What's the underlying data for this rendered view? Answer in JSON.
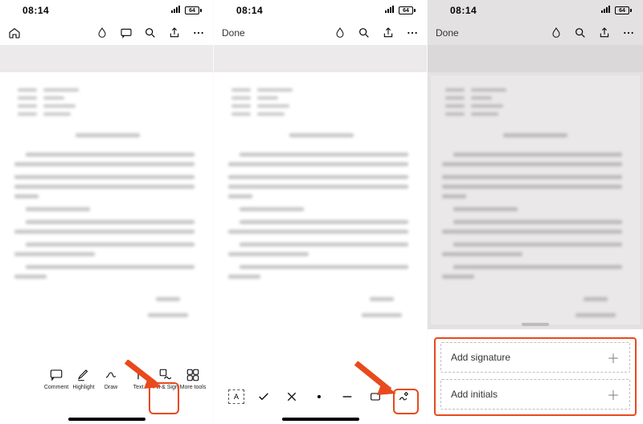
{
  "status": {
    "time": "08:14",
    "battery_label": "64"
  },
  "nav": {
    "done": "Done"
  },
  "toolbar_main": {
    "items": [
      {
        "label": "Comment"
      },
      {
        "label": "Highlight"
      },
      {
        "label": "Draw"
      },
      {
        "label": "Text"
      },
      {
        "label": "Fill & Sign"
      },
      {
        "label": "More tools"
      }
    ],
    "highlight_index": 4
  },
  "sign_panel": {
    "options": [
      {
        "label": "Add signature"
      },
      {
        "label": "Add initials"
      }
    ]
  }
}
